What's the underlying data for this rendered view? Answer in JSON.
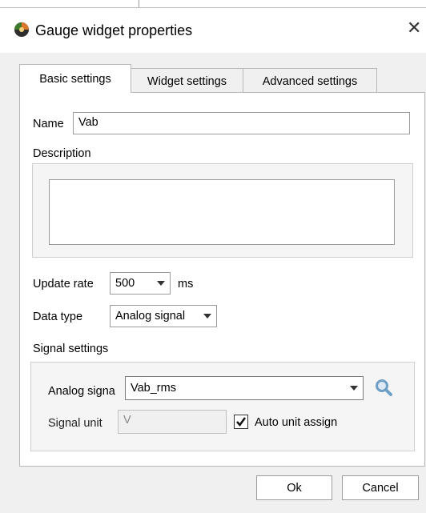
{
  "window": {
    "title": "Gauge widget properties",
    "close_glyph": "✕",
    "app_icon": "ball-icon"
  },
  "tabs": [
    {
      "label": "Basic settings",
      "active": true
    },
    {
      "label": "Widget settings",
      "active": false
    },
    {
      "label": "Advanced settings",
      "active": false
    }
  ],
  "basic": {
    "name_label": "Name",
    "name_value": "Vab",
    "description_label": "Description",
    "description_value": "",
    "update_rate_label": "Update rate",
    "update_rate_value": "500",
    "update_rate_unit": "ms",
    "data_type_label": "Data type",
    "data_type_value": "Analog signal",
    "signal_settings_label": "Signal settings",
    "analog_signal_label": "Analog signa",
    "analog_signal_value": "Vab_rms",
    "signal_unit_label": "Signal unit",
    "signal_unit_value": "V",
    "auto_unit_label": "Auto unit assign",
    "auto_unit_checked": true,
    "search_icon": "magnifier-icon"
  },
  "buttons": {
    "ok": "Ok",
    "cancel": "Cancel"
  },
  "colors": {
    "accent_search": "#6f9fc6",
    "icon_green": "#3f7a2f",
    "icon_orange": "#d9772a"
  }
}
